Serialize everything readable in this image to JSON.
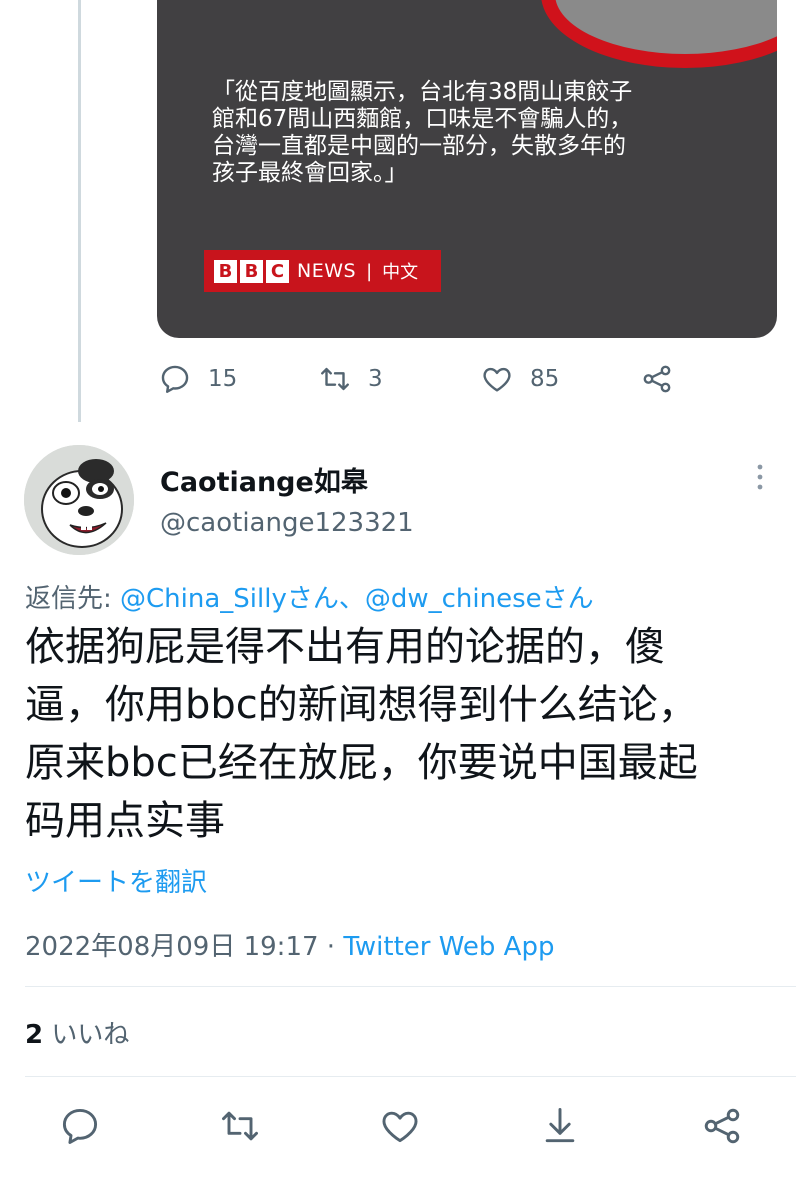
{
  "quoted_card": {
    "quote_lines": [
      "「從百度地圖顯示，台北有38間山東餃子",
      "館和67間山西麵館，口味是不會騙人的，",
      "台灣一直都是中國的一部分，失散多年的",
      "孩子最終會回家。」"
    ],
    "badge": {
      "letters": [
        "B",
        "B",
        "C"
      ],
      "news": "NEWS",
      "separator": "|",
      "lang": "中文"
    }
  },
  "quoted_actions": {
    "replies": "15",
    "retweets": "3",
    "likes": "85"
  },
  "reply": {
    "display_name": "Caotiange如皋",
    "handle": "@caotiange123321",
    "reply_to_label": "返信先: ",
    "reply_to_users": "@China_Sillyさん、@dw_chineseさん",
    "text_lines": [
      "依据狗屁是得不出有用的论据的，傻",
      "逼，你用bbc的新闻想得到什么结论，",
      "原来bbc已经在放屁，你要说中国最起",
      "码用点实事"
    ],
    "translate_label": "ツイートを翻訳",
    "timestamp": "2022年08月09日 19:17 · ",
    "source": "Twitter Web App",
    "like_count": "2",
    "like_label": " いいね"
  },
  "icons": {
    "quoted": [
      "reply-icon",
      "retweet-icon",
      "like-icon",
      "share-icon"
    ],
    "main": [
      "reply-icon",
      "retweet-icon",
      "like-icon",
      "bookmark-icon",
      "share-icon"
    ]
  },
  "colors": {
    "accent": "#1d9bf0",
    "muted": "#536471",
    "card_bg": "#414042",
    "bbc_red": "#c8141c"
  }
}
